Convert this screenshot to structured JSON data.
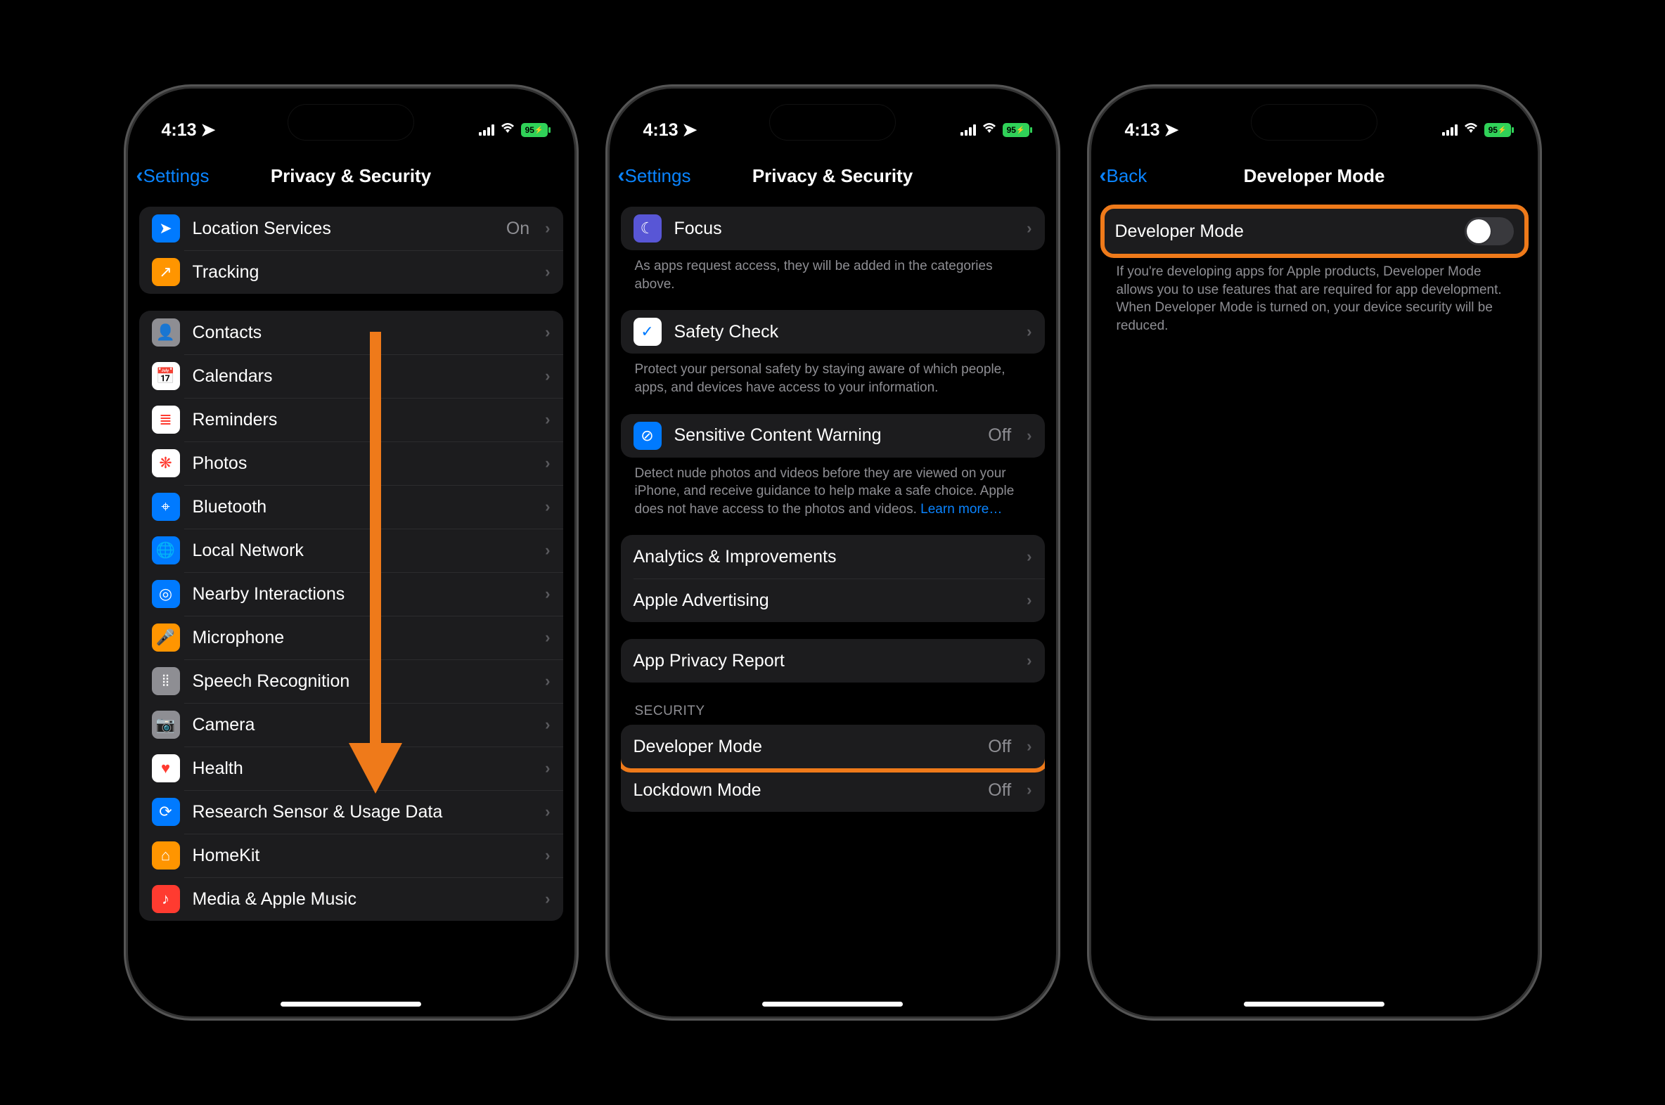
{
  "status": {
    "time": "4:13",
    "battery": "95"
  },
  "phone1": {
    "back": "Settings",
    "title": "Privacy & Security",
    "group1": [
      {
        "icon": "location-icon",
        "bg": "bg-blue",
        "glyph": "➤",
        "label": "Location Services",
        "val": "On"
      },
      {
        "icon": "tracking-icon",
        "bg": "bg-orange",
        "glyph": "↗",
        "label": "Tracking"
      }
    ],
    "group2": [
      {
        "icon": "contacts-icon",
        "bg": "bg-grey",
        "glyph": "👤",
        "label": "Contacts"
      },
      {
        "icon": "calendars-icon",
        "bg": "bg-white",
        "glyph": "📅",
        "label": "Calendars"
      },
      {
        "icon": "reminders-icon",
        "bg": "bg-white",
        "glyph": "≣",
        "label": "Reminders"
      },
      {
        "icon": "photos-icon",
        "bg": "bg-white",
        "glyph": "❋",
        "label": "Photos"
      },
      {
        "icon": "bluetooth-icon",
        "bg": "bg-blue",
        "glyph": "⌖",
        "label": "Bluetooth"
      },
      {
        "icon": "local-network-icon",
        "bg": "bg-blue",
        "glyph": "🌐",
        "label": "Local Network"
      },
      {
        "icon": "nearby-icon",
        "bg": "bg-blue",
        "glyph": "◎",
        "label": "Nearby Interactions"
      },
      {
        "icon": "microphone-icon",
        "bg": "bg-orange",
        "glyph": "🎤",
        "label": "Microphone"
      },
      {
        "icon": "speech-icon",
        "bg": "bg-grey",
        "glyph": "⦙⦙",
        "label": "Speech Recognition"
      },
      {
        "icon": "camera-icon",
        "bg": "bg-grey",
        "glyph": "📷",
        "label": "Camera"
      },
      {
        "icon": "health-icon",
        "bg": "bg-white",
        "glyph": "♥",
        "label": "Health"
      },
      {
        "icon": "research-icon",
        "bg": "bg-blue",
        "glyph": "⟳",
        "label": "Research Sensor & Usage Data"
      },
      {
        "icon": "homekit-icon",
        "bg": "bg-orange",
        "glyph": "⌂",
        "label": "HomeKit"
      },
      {
        "icon": "media-icon",
        "bg": "bg-red",
        "glyph": "♪",
        "label": "Media & Apple Music"
      }
    ]
  },
  "phone2": {
    "back": "Settings",
    "title": "Privacy & Security",
    "focus": {
      "label": "Focus"
    },
    "focus_footer": "As apps request access, they will be added in the categories above.",
    "safety": {
      "label": "Safety Check"
    },
    "safety_footer": "Protect your personal safety by staying aware of which people, apps, and devices have access to your information.",
    "scw": {
      "label": "Sensitive Content Warning",
      "val": "Off"
    },
    "scw_footer_1": "Detect nude photos and videos before they are viewed on your iPhone, and receive guidance to help make a safe choice. Apple does not have access to the photos and videos. ",
    "scw_footer_link": "Learn more…",
    "analytics": [
      {
        "label": "Analytics & Improvements"
      },
      {
        "label": "Apple Advertising"
      }
    ],
    "app_privacy": {
      "label": "App Privacy Report"
    },
    "security_header": "SECURITY",
    "security": [
      {
        "label": "Developer Mode",
        "val": "Off",
        "hl": true
      },
      {
        "label": "Lockdown Mode",
        "val": "Off"
      }
    ]
  },
  "phone3": {
    "back": "Back",
    "title": "Developer Mode",
    "row_label": "Developer Mode",
    "footer": "If you're developing apps for Apple products, Developer Mode allows you to use features that are required for app development. When Developer Mode is turned on, your device security will be reduced."
  }
}
